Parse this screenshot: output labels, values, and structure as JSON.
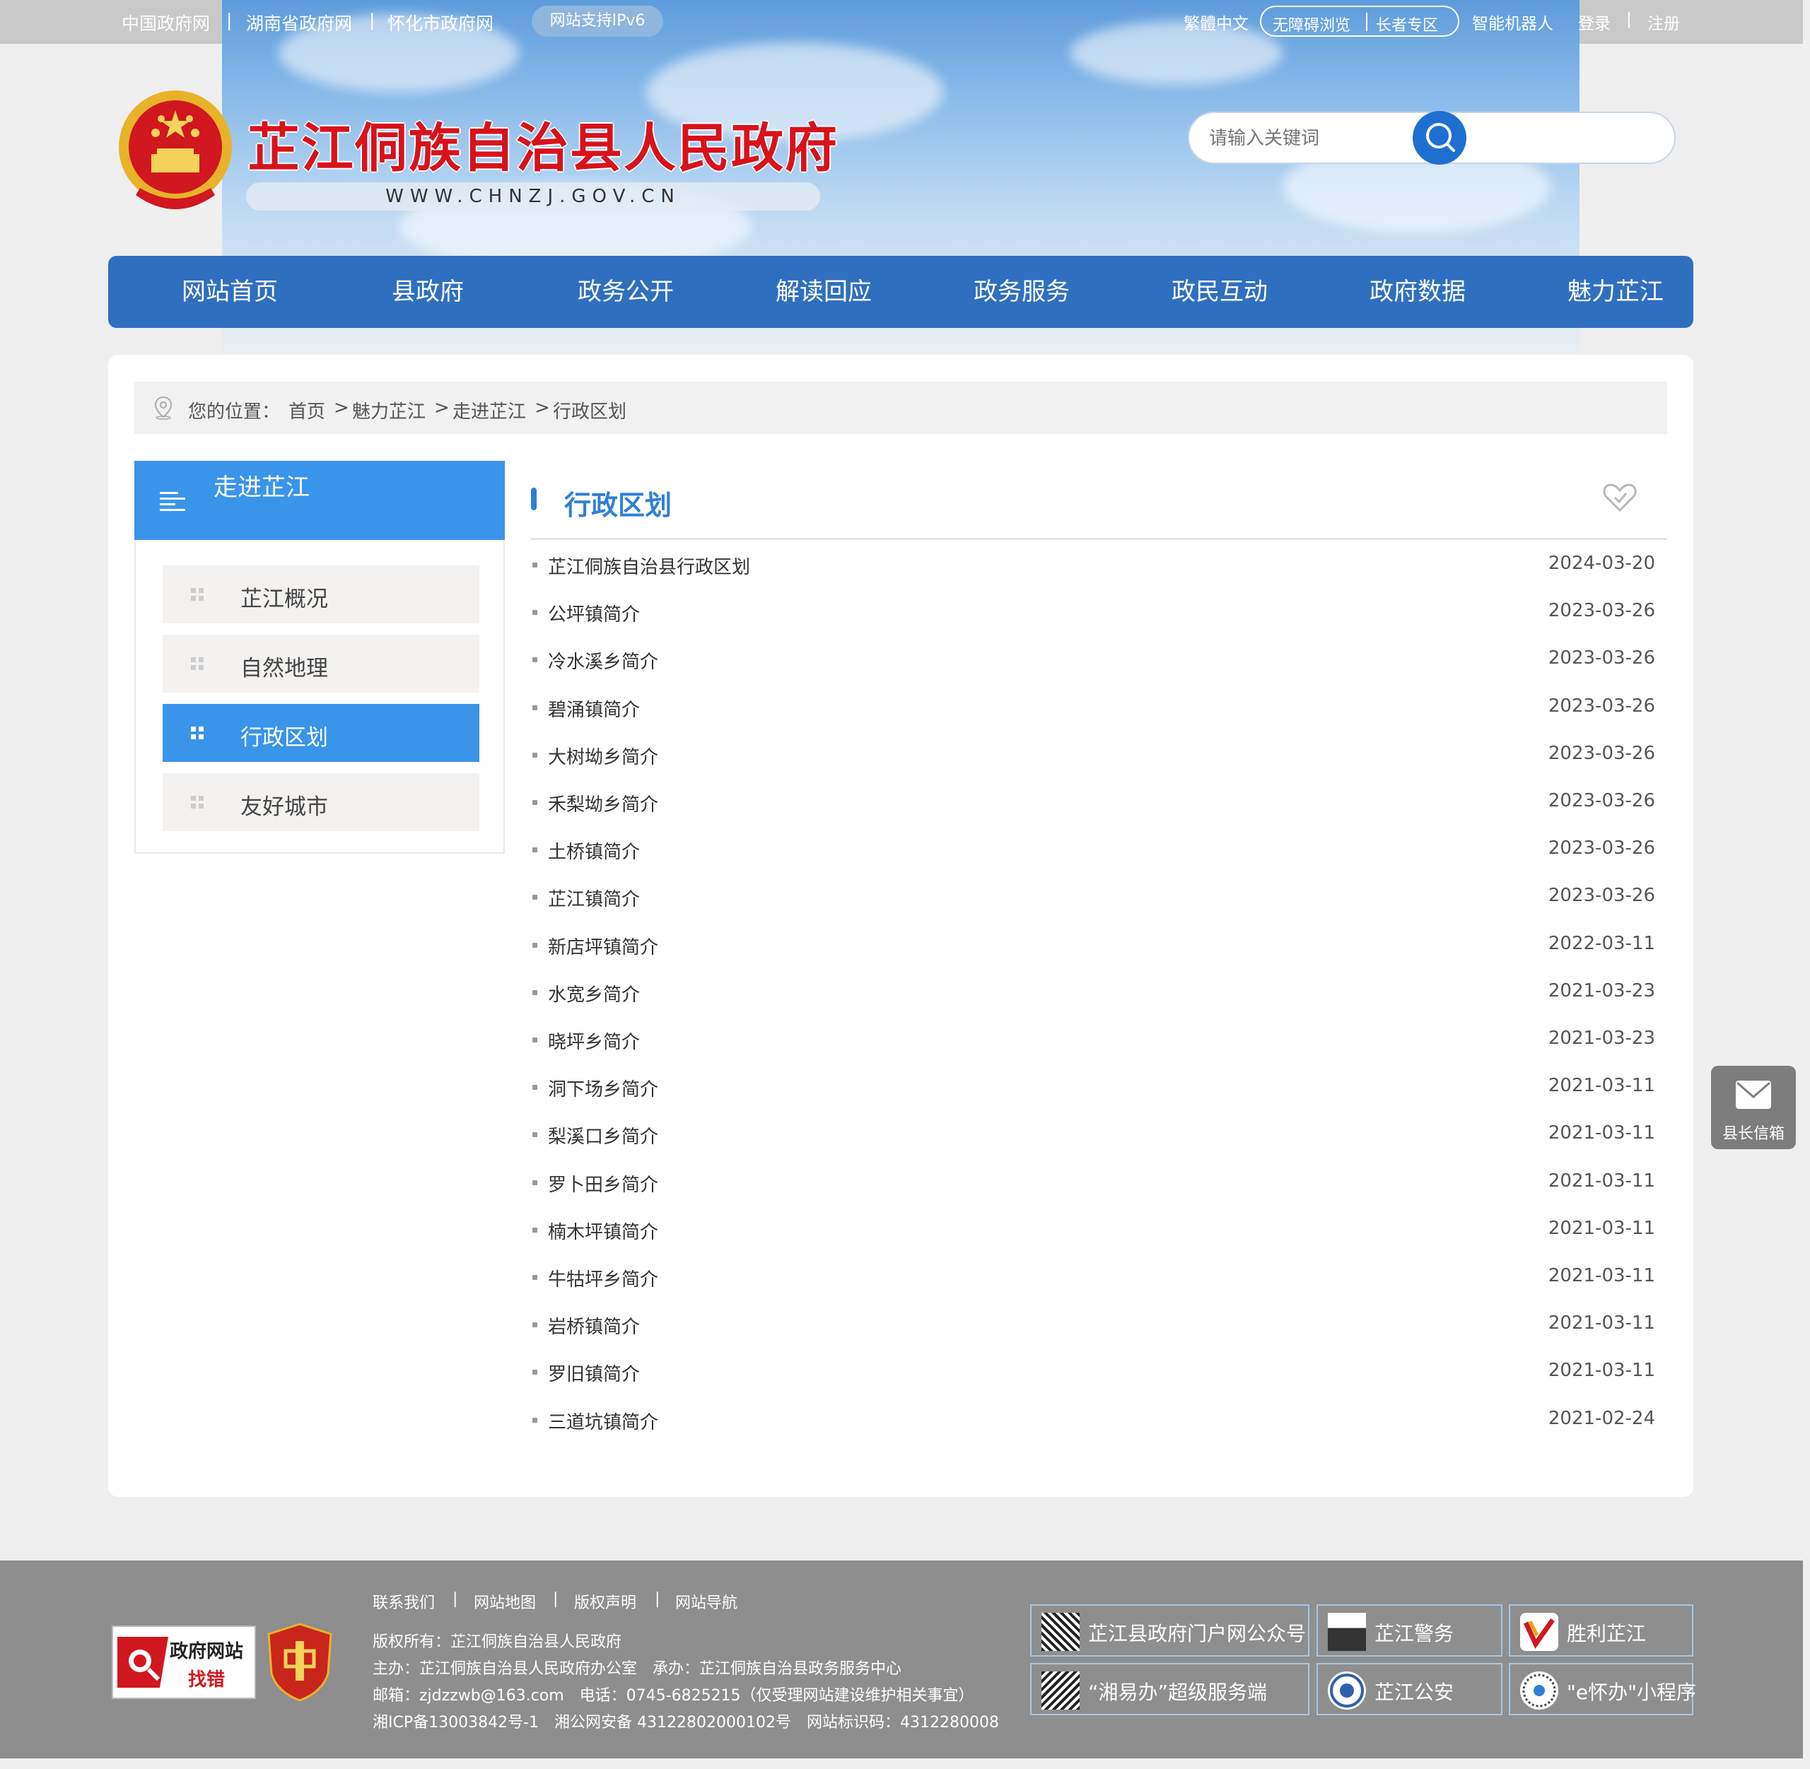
{
  "topbar": {
    "links": [
      "中国政府网",
      "湖南省政府网",
      "怀化市政府网"
    ],
    "ipv6": "网站支持IPv6",
    "traditional": "繁體中文",
    "accessible": "无障碍浏览",
    "elderly": "长者专区",
    "robot": "智能机器人",
    "login": "登录",
    "register": "注册"
  },
  "header": {
    "title": "芷江侗族自治县人民政府",
    "url": "WWW.CHNZJ.GOV.CN",
    "search_placeholder": "请输入关键词"
  },
  "nav": [
    "网站首页",
    "县政府",
    "政务公开",
    "解读回应",
    "政务服务",
    "政民互动",
    "政府数据",
    "魅力芷江"
  ],
  "breadcrumb": {
    "prefix": "您的位置：",
    "items": [
      "首页",
      "魅力芷江",
      "走进芷江",
      "行政区划"
    ],
    "sep": ">"
  },
  "sidebar": {
    "title": "走进芷江",
    "items": [
      "芷江概况",
      "自然地理",
      "行政区划",
      "友好城市"
    ],
    "active_index": 2
  },
  "content": {
    "title": "行政区划",
    "list": [
      {
        "title": "芷江侗族自治县行政区划",
        "date": "2024-03-20"
      },
      {
        "title": "公坪镇简介",
        "date": "2023-03-26"
      },
      {
        "title": "冷水溪乡简介",
        "date": "2023-03-26"
      },
      {
        "title": "碧涌镇简介",
        "date": "2023-03-26"
      },
      {
        "title": "大树坳乡简介",
        "date": "2023-03-26"
      },
      {
        "title": "禾梨坳乡简介",
        "date": "2023-03-26"
      },
      {
        "title": "土桥镇简介",
        "date": "2023-03-26"
      },
      {
        "title": "芷江镇简介",
        "date": "2023-03-26"
      },
      {
        "title": "新店坪镇简介",
        "date": "2022-03-11"
      },
      {
        "title": "水宽乡简介",
        "date": "2021-03-23"
      },
      {
        "title": "晓坪乡简介",
        "date": "2021-03-23"
      },
      {
        "title": "洞下场乡简介",
        "date": "2021-03-11"
      },
      {
        "title": "梨溪口乡简介",
        "date": "2021-03-11"
      },
      {
        "title": "罗卜田乡简介",
        "date": "2021-03-11"
      },
      {
        "title": "楠木坪镇简介",
        "date": "2021-03-11"
      },
      {
        "title": "牛牯坪乡简介",
        "date": "2021-03-11"
      },
      {
        "title": "岩桥镇简介",
        "date": "2021-03-11"
      },
      {
        "title": "罗旧镇简介",
        "date": "2021-03-11"
      },
      {
        "title": "三道坑镇简介",
        "date": "2021-02-24"
      }
    ]
  },
  "mailbox": {
    "label": "县长信箱"
  },
  "footer": {
    "links": [
      "联系我们",
      "网站地图",
      "版权声明",
      "网站导航"
    ],
    "badge_line1": "政府网站",
    "badge_line2": "找错",
    "copyright": "版权所有：芷江侗族自治县人民政府",
    "sponsor": "主办：芷江侗族自治县人民政府办公室　承办：芷江侗族自治县政务服务中心",
    "contact": "邮箱：zjdzzwb@163.com　电话：0745-6825215（仅受理网站建设维护相关事宜）",
    "icp": "湘ICP备13003842号-1　湘公网安备 43122802000102号　网站标识码：4312280008",
    "tiles": [
      "芷江县政府门户网公众号",
      "芷江警务",
      "胜利芷江",
      "“湘易办”超级服务端",
      "芷江公安",
      "\"e怀办\"小程序"
    ]
  },
  "colors": {
    "nav": "#2f6fc0",
    "accent": "#3a94ea",
    "title_red": "#d8121b",
    "footer": "#8e8e8e"
  }
}
